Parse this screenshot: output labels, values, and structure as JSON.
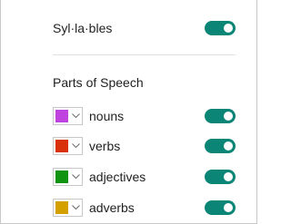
{
  "syllables": {
    "label": "Syl·la·bles",
    "enabled": true
  },
  "parts_of_speech": {
    "heading": "Parts of Speech",
    "items": [
      {
        "label": "nouns",
        "color": "#c043e0",
        "enabled": true
      },
      {
        "label": "verbs",
        "color": "#d9310b",
        "enabled": true
      },
      {
        "label": "adjectives",
        "color": "#119511",
        "enabled": true
      },
      {
        "label": "adverbs",
        "color": "#d4a000",
        "enabled": true
      }
    ]
  },
  "colors": {
    "toggle_on": "#0b8576"
  },
  "icons": {
    "picker": "chevron-down-icon"
  }
}
